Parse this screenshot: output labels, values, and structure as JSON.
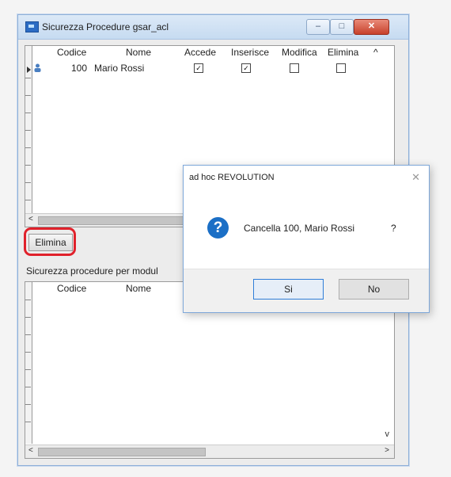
{
  "window": {
    "title": "Sicurezza Procedure gsar_acl",
    "minimize": "–",
    "maximize": "□",
    "close": "✕"
  },
  "top_grid": {
    "columns": [
      "Codice",
      "Nome",
      "Accede",
      "Inserisce",
      "Modifica",
      "Elimina"
    ],
    "rows": [
      {
        "codice": "100",
        "nome": "Mario Rossi",
        "accede": true,
        "inserisce": true,
        "modifica": false,
        "elimina": false
      }
    ],
    "scroll_left": "<",
    "scroll_up": "^"
  },
  "elimina_button": {
    "label": "Elimina"
  },
  "bottom_section": {
    "label": "Sicurezza procedure per modul",
    "columns": [
      "Codice",
      "Nome"
    ],
    "scroll_left": "<",
    "scroll_right": ">",
    "scroll_down": "v"
  },
  "dialog": {
    "title": "ad hoc REVOLUTION",
    "close": "✕",
    "icon": "question-icon",
    "icon_glyph": "?",
    "message": "Cancella 100, Mario Rossi",
    "question_mark": "?",
    "yes_label": "Si",
    "no_label": "No"
  },
  "colors": {
    "highlight": "#e0212b",
    "dialog_accent": "#1b6fc6"
  }
}
